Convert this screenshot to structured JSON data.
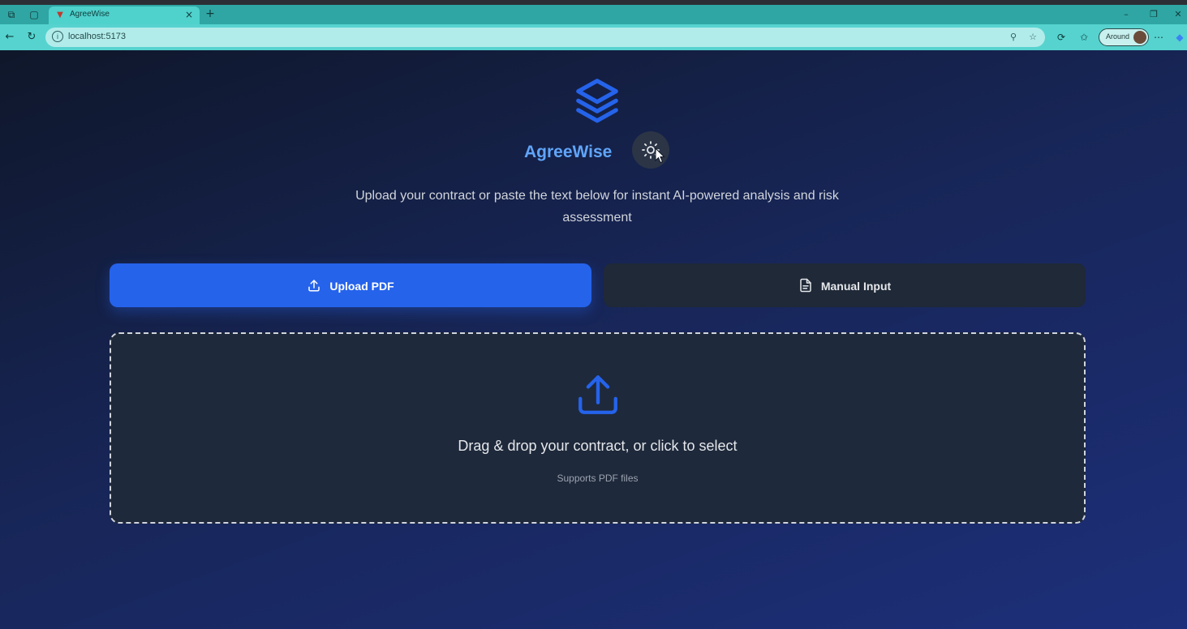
{
  "browser": {
    "tab_title": "AgreeWise",
    "url": "localhost:5173",
    "profile_label": "Around"
  },
  "app": {
    "brand": "AgreeWise",
    "subtitle": "Upload your contract or paste the text below for instant AI-powered analysis and risk assessment",
    "theme_toggle_icon": "sun-icon"
  },
  "mode_tabs": [
    {
      "label": "Upload PDF",
      "icon": "upload-icon",
      "active": true
    },
    {
      "label": "Manual Input",
      "icon": "document-icon",
      "active": false
    }
  ],
  "dropzone": {
    "title": "Drag & drop your contract, or click to select",
    "subtitle": "Supports PDF files"
  },
  "colors": {
    "accent": "#2563eb",
    "brand_text": "#60a5fa",
    "tab_bar": "#2fa6a4"
  }
}
